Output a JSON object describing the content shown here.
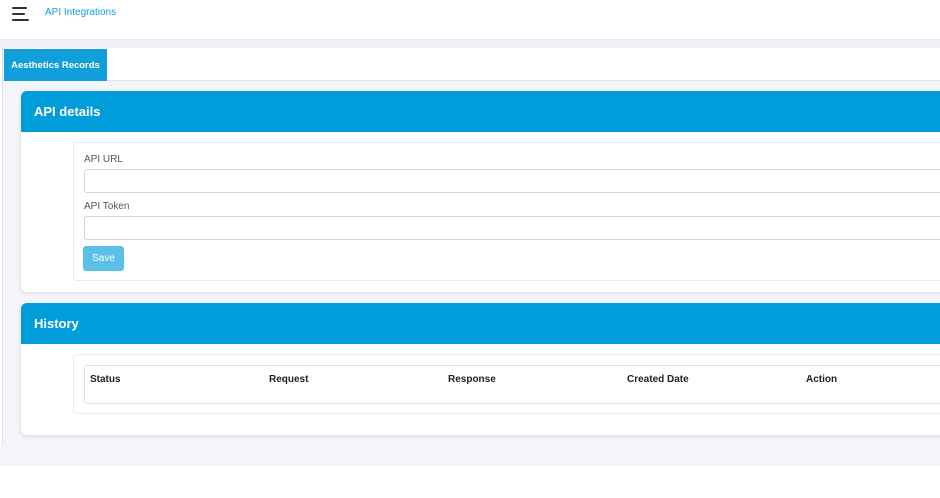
{
  "header": {
    "title": "API Integrations"
  },
  "tabs": [
    {
      "label": "Aesthetics Records",
      "active": true
    }
  ],
  "api_details": {
    "title": "API details",
    "url_label": "API URL",
    "url_value": "",
    "token_label": "API Token",
    "token_value": "",
    "save_label": "Save"
  },
  "history": {
    "title": "History",
    "columns": [
      "Status",
      "Request",
      "Response",
      "Created Date",
      "Action"
    ],
    "rows": []
  },
  "colors": {
    "accent": "#019ddb",
    "save_button": "#5bc0e8",
    "link": "#119fdb"
  }
}
